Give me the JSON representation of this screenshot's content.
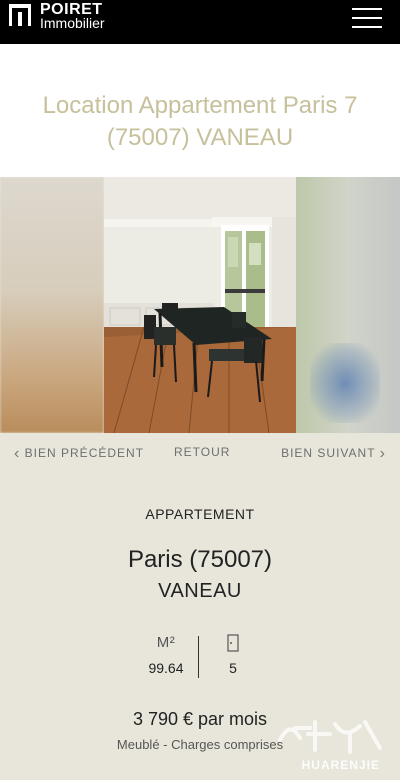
{
  "header": {
    "logo_line1": "POIRET",
    "logo_line2": "Immobilier"
  },
  "page": {
    "title": "Location Appartement Paris 7 (75007) VANEAU"
  },
  "gallery_nav": {
    "prev_label": "BIEN PRÉCÉDENT",
    "back_label": "RETOUR",
    "next_label": "BIEN SUIVANT"
  },
  "listing": {
    "type": "APPARTEMENT",
    "city": "Paris (75007)",
    "district": "VANEAU",
    "area_unit": "M²",
    "area_value": "99.64",
    "rooms_value": "5",
    "price": "3 790 € par mois",
    "price_note": "Meublé - Charges comprises"
  },
  "watermark": {
    "text": "HUARENJIE"
  },
  "colors": {
    "header_bg": "#000000",
    "title_color": "#c6c09b",
    "panel_bg": "#e8e6da"
  }
}
